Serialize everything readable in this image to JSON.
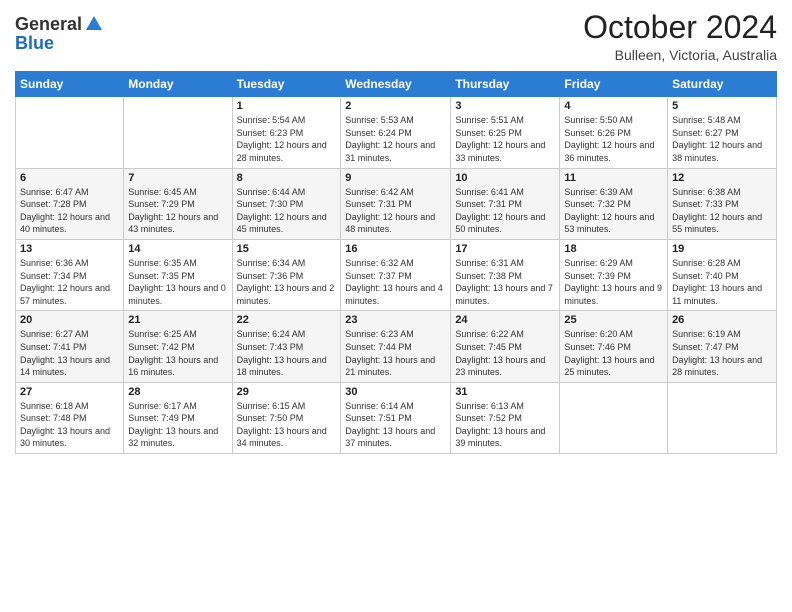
{
  "header": {
    "logo_general": "General",
    "logo_blue": "Blue",
    "month_title": "October 2024",
    "location": "Bulleen, Victoria, Australia"
  },
  "days_of_week": [
    "Sunday",
    "Monday",
    "Tuesday",
    "Wednesday",
    "Thursday",
    "Friday",
    "Saturday"
  ],
  "weeks": [
    [
      {
        "day": "",
        "info": ""
      },
      {
        "day": "",
        "info": ""
      },
      {
        "day": "1",
        "info": "Sunrise: 5:54 AM\nSunset: 6:23 PM\nDaylight: 12 hours and 28 minutes."
      },
      {
        "day": "2",
        "info": "Sunrise: 5:53 AM\nSunset: 6:24 PM\nDaylight: 12 hours and 31 minutes."
      },
      {
        "day": "3",
        "info": "Sunrise: 5:51 AM\nSunset: 6:25 PM\nDaylight: 12 hours and 33 minutes."
      },
      {
        "day": "4",
        "info": "Sunrise: 5:50 AM\nSunset: 6:26 PM\nDaylight: 12 hours and 36 minutes."
      },
      {
        "day": "5",
        "info": "Sunrise: 5:48 AM\nSunset: 6:27 PM\nDaylight: 12 hours and 38 minutes."
      }
    ],
    [
      {
        "day": "6",
        "info": "Sunrise: 6:47 AM\nSunset: 7:28 PM\nDaylight: 12 hours and 40 minutes."
      },
      {
        "day": "7",
        "info": "Sunrise: 6:45 AM\nSunset: 7:29 PM\nDaylight: 12 hours and 43 minutes."
      },
      {
        "day": "8",
        "info": "Sunrise: 6:44 AM\nSunset: 7:30 PM\nDaylight: 12 hours and 45 minutes."
      },
      {
        "day": "9",
        "info": "Sunrise: 6:42 AM\nSunset: 7:31 PM\nDaylight: 12 hours and 48 minutes."
      },
      {
        "day": "10",
        "info": "Sunrise: 6:41 AM\nSunset: 7:31 PM\nDaylight: 12 hours and 50 minutes."
      },
      {
        "day": "11",
        "info": "Sunrise: 6:39 AM\nSunset: 7:32 PM\nDaylight: 12 hours and 53 minutes."
      },
      {
        "day": "12",
        "info": "Sunrise: 6:38 AM\nSunset: 7:33 PM\nDaylight: 12 hours and 55 minutes."
      }
    ],
    [
      {
        "day": "13",
        "info": "Sunrise: 6:36 AM\nSunset: 7:34 PM\nDaylight: 12 hours and 57 minutes."
      },
      {
        "day": "14",
        "info": "Sunrise: 6:35 AM\nSunset: 7:35 PM\nDaylight: 13 hours and 0 minutes."
      },
      {
        "day": "15",
        "info": "Sunrise: 6:34 AM\nSunset: 7:36 PM\nDaylight: 13 hours and 2 minutes."
      },
      {
        "day": "16",
        "info": "Sunrise: 6:32 AM\nSunset: 7:37 PM\nDaylight: 13 hours and 4 minutes."
      },
      {
        "day": "17",
        "info": "Sunrise: 6:31 AM\nSunset: 7:38 PM\nDaylight: 13 hours and 7 minutes."
      },
      {
        "day": "18",
        "info": "Sunrise: 6:29 AM\nSunset: 7:39 PM\nDaylight: 13 hours and 9 minutes."
      },
      {
        "day": "19",
        "info": "Sunrise: 6:28 AM\nSunset: 7:40 PM\nDaylight: 13 hours and 11 minutes."
      }
    ],
    [
      {
        "day": "20",
        "info": "Sunrise: 6:27 AM\nSunset: 7:41 PM\nDaylight: 13 hours and 14 minutes."
      },
      {
        "day": "21",
        "info": "Sunrise: 6:25 AM\nSunset: 7:42 PM\nDaylight: 13 hours and 16 minutes."
      },
      {
        "day": "22",
        "info": "Sunrise: 6:24 AM\nSunset: 7:43 PM\nDaylight: 13 hours and 18 minutes."
      },
      {
        "day": "23",
        "info": "Sunrise: 6:23 AM\nSunset: 7:44 PM\nDaylight: 13 hours and 21 minutes."
      },
      {
        "day": "24",
        "info": "Sunrise: 6:22 AM\nSunset: 7:45 PM\nDaylight: 13 hours and 23 minutes."
      },
      {
        "day": "25",
        "info": "Sunrise: 6:20 AM\nSunset: 7:46 PM\nDaylight: 13 hours and 25 minutes."
      },
      {
        "day": "26",
        "info": "Sunrise: 6:19 AM\nSunset: 7:47 PM\nDaylight: 13 hours and 28 minutes."
      }
    ],
    [
      {
        "day": "27",
        "info": "Sunrise: 6:18 AM\nSunset: 7:48 PM\nDaylight: 13 hours and 30 minutes."
      },
      {
        "day": "28",
        "info": "Sunrise: 6:17 AM\nSunset: 7:49 PM\nDaylight: 13 hours and 32 minutes."
      },
      {
        "day": "29",
        "info": "Sunrise: 6:15 AM\nSunset: 7:50 PM\nDaylight: 13 hours and 34 minutes."
      },
      {
        "day": "30",
        "info": "Sunrise: 6:14 AM\nSunset: 7:51 PM\nDaylight: 13 hours and 37 minutes."
      },
      {
        "day": "31",
        "info": "Sunrise: 6:13 AM\nSunset: 7:52 PM\nDaylight: 13 hours and 39 minutes."
      },
      {
        "day": "",
        "info": ""
      },
      {
        "day": "",
        "info": ""
      }
    ]
  ]
}
